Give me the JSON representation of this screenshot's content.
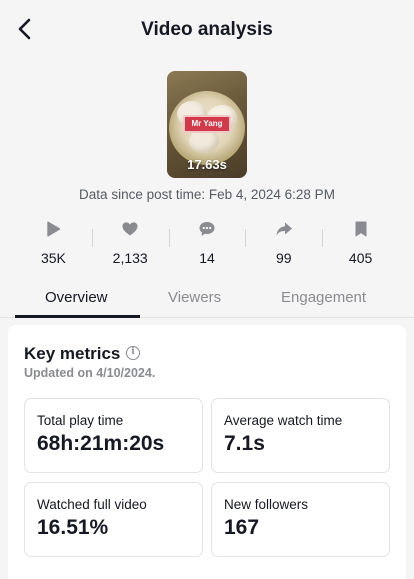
{
  "header": {
    "title": "Video analysis",
    "back_icon": "chevron-left-icon"
  },
  "video": {
    "thumbnail_caption": "Mr Yang",
    "duration": "17.63s"
  },
  "data_since": "Data since post time: Feb 4, 2024 6:28 PM",
  "stats": [
    {
      "icon": "play-icon",
      "value": "35K"
    },
    {
      "icon": "heart-icon",
      "value": "2,133"
    },
    {
      "icon": "comment-icon",
      "value": "14"
    },
    {
      "icon": "share-icon",
      "value": "99"
    },
    {
      "icon": "bookmark-icon",
      "value": "405"
    }
  ],
  "tabs": [
    {
      "label": "Overview",
      "active": true
    },
    {
      "label": "Viewers",
      "active": false
    },
    {
      "label": "Engagement",
      "active": false
    }
  ],
  "key_metrics": {
    "title": "Key metrics",
    "updated": "Updated on 4/10/2024.",
    "info_icon": "info-icon",
    "metrics": [
      {
        "label": "Total play time",
        "value": "68h:21m:20s"
      },
      {
        "label": "Average watch time",
        "value": "7.1s"
      },
      {
        "label": "Watched full video",
        "value": "16.51%"
      },
      {
        "label": "New followers",
        "value": "167"
      }
    ]
  },
  "colors": {
    "background": "#f5f5f5",
    "text_primary": "#161823",
    "text_secondary": "#8a8b91",
    "icon_gray": "#8a8b91",
    "card_background": "#ffffff"
  }
}
